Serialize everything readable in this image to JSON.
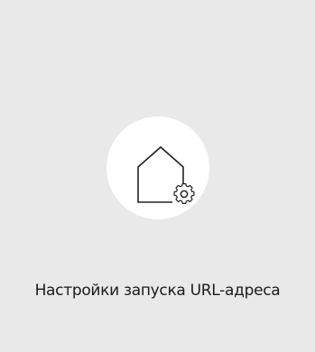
{
  "tile": {
    "label": "Настройки запуска URL-адреса",
    "icon": "home-settings-icon",
    "background_color": "#e9e9e9",
    "circle_color": "#ffffff",
    "icon_color": "#222222"
  }
}
